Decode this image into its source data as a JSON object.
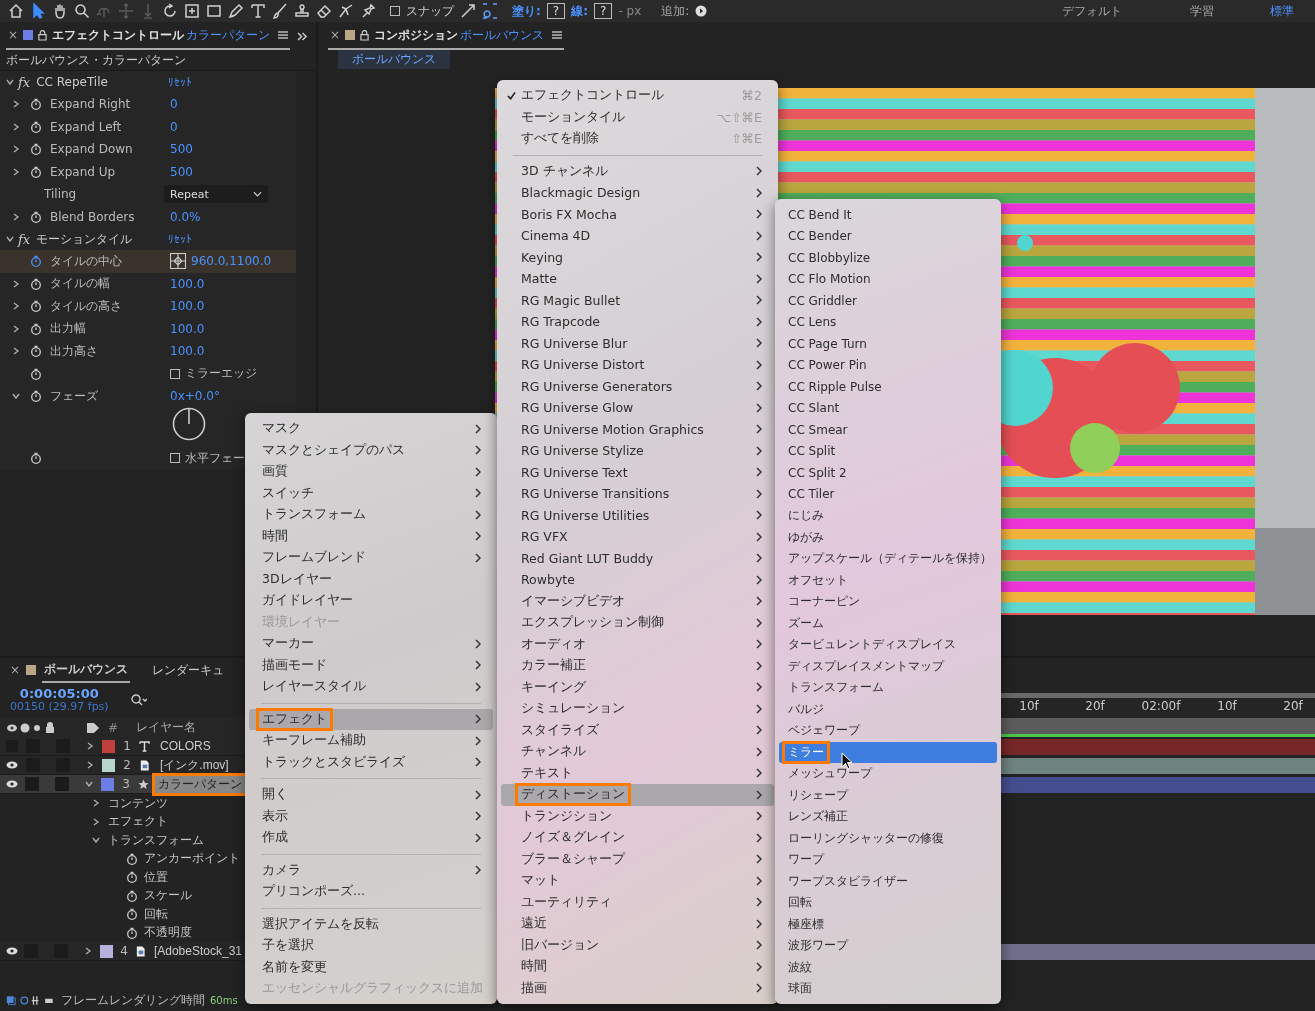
{
  "toolbar": {
    "tools": [
      {
        "kind": "home",
        "selected": false,
        "disabled": false
      },
      {
        "kind": "select",
        "selected": true,
        "disabled": false
      },
      {
        "kind": "hand",
        "selected": false,
        "disabled": false
      },
      {
        "kind": "zoom",
        "selected": false,
        "disabled": false
      },
      {
        "kind": "orbit",
        "selected": false,
        "disabled": true
      },
      {
        "kind": "pan",
        "selected": false,
        "disabled": true
      },
      {
        "kind": "dolly",
        "selected": false,
        "disabled": true
      },
      {
        "kind": "rotate",
        "selected": false,
        "disabled": false
      },
      {
        "kind": "anchor",
        "selected": false,
        "disabled": false
      },
      {
        "kind": "rect",
        "selected": false,
        "disabled": false
      },
      {
        "kind": "pen",
        "selected": false,
        "disabled": false
      },
      {
        "kind": "text",
        "selected": false,
        "disabled": false
      },
      {
        "kind": "brush",
        "selected": false,
        "disabled": false
      },
      {
        "kind": "stamp",
        "selected": false,
        "disabled": false
      },
      {
        "kind": "eraser",
        "selected": false,
        "disabled": false
      },
      {
        "kind": "roto",
        "selected": false,
        "disabled": false
      },
      {
        "kind": "pin",
        "selected": false,
        "disabled": false
      }
    ],
    "snap": {
      "label": "スナップ",
      "checked": false
    },
    "fill_label": "塗り:",
    "fill_value": "?",
    "stroke_label": "線:",
    "stroke_value": "?",
    "stroke_width": "- px",
    "add_label": "追加:",
    "workspaces": [
      {
        "label": "デフォルト",
        "selected": false
      },
      {
        "label": "学習",
        "selected": false
      },
      {
        "label": "標準",
        "selected": true
      }
    ]
  },
  "effect_panel": {
    "close": "×",
    "title": "エフェクトコントロール",
    "layer": "カラーパターン",
    "subtitle": "ボールバウンス・カラーパターン",
    "effects": [
      {
        "fx": "fx",
        "name": "CC RepeTile",
        "reset": "ﾘｾｯﾄ",
        "expanded": true,
        "params": [
          {
            "kind": "number",
            "name": "Expand Right",
            "value": "0",
            "expandable": true,
            "expanded": false,
            "selected": false
          },
          {
            "kind": "number",
            "name": "Expand Left",
            "value": "0",
            "expandable": true,
            "expanded": false,
            "selected": false
          },
          {
            "kind": "number",
            "name": "Expand Down",
            "value": "500",
            "expandable": true,
            "expanded": false,
            "selected": false
          },
          {
            "kind": "number",
            "name": "Expand Up",
            "value": "500",
            "expandable": true,
            "expanded": false,
            "selected": false
          },
          {
            "kind": "dropdown",
            "name": "Tiling",
            "value": "Repeat",
            "selected": false
          },
          {
            "kind": "number",
            "name": "Blend Borders",
            "value": "0.0%",
            "expandable": true,
            "expanded": false,
            "selected": false
          }
        ]
      },
      {
        "fx": "fx",
        "name": "モーションタイル",
        "reset": "ﾘｾｯﾄ",
        "expanded": true,
        "params": [
          {
            "kind": "point",
            "name": "タイルの中心",
            "value": "960.0,1100.0",
            "selected": true
          },
          {
            "kind": "number",
            "name": "タイルの幅",
            "value": "100.0",
            "expandable": true,
            "expanded": false,
            "selected": false
          },
          {
            "kind": "number",
            "name": "タイルの高さ",
            "value": "100.0",
            "expandable": true,
            "expanded": false,
            "selected": false
          },
          {
            "kind": "number",
            "name": "出力幅",
            "value": "100.0",
            "expandable": true,
            "expanded": false,
            "selected": false
          },
          {
            "kind": "number",
            "name": "出力高さ",
            "value": "100.0",
            "expandable": true,
            "expanded": false,
            "selected": false
          },
          {
            "kind": "checkbox",
            "label": "ミラーエッジ",
            "checked": false,
            "selected": false
          },
          {
            "kind": "angle",
            "name": "フェーズ",
            "value": "0x+0.0°",
            "expandable": true,
            "expanded": true,
            "selected": false
          },
          {
            "kind": "checkbox",
            "label": "水平フェー",
            "checked": false,
            "selected": false
          }
        ]
      }
    ]
  },
  "composition_panel": {
    "close": "×",
    "title": "コンポジション",
    "comp": "ボールバウンス",
    "tabs": [
      {
        "label": "ボールバウンス",
        "selected": true
      }
    ]
  },
  "timeline": {
    "close": "×",
    "tabs": [
      {
        "label": "ボールバウンス",
        "selected": true
      },
      {
        "label": "レンダーキュ",
        "selected": false
      }
    ],
    "timecode": "0:00:05:00",
    "frames": "00150 (29.97 fps)",
    "col_number": "#",
    "col_name": "レイヤー名",
    "ruler": [
      "10f",
      "20f",
      "02:00f",
      "10f",
      "20f"
    ],
    "layers": [
      {
        "number": "1",
        "color": "#c0403e",
        "kind": "text",
        "name": "COLORS",
        "visible": false,
        "expanded": false,
        "selected": false,
        "annotated": false
      },
      {
        "number": "2",
        "color": "#b5d5cd",
        "kind": "footage",
        "name": "[インク.mov]",
        "visible": true,
        "expanded": false,
        "selected": false,
        "annotated": false
      },
      {
        "number": "3",
        "color": "#6d7de6",
        "kind": "shape",
        "name": "カラーパターン",
        "visible": true,
        "expanded": true,
        "selected": true,
        "annotated": true,
        "children": [
          {
            "kind": "group",
            "name": "コンテンツ",
            "expanded": false
          },
          {
            "kind": "group",
            "name": "エフェクト",
            "expanded": false
          },
          {
            "kind": "group",
            "name": "トランスフォーム",
            "expanded": true,
            "children": [
              {
                "kind": "property",
                "name": "アンカーポイント"
              },
              {
                "kind": "property",
                "name": "位置"
              },
              {
                "kind": "property",
                "name": "スケール"
              },
              {
                "kind": "property",
                "name": "回転"
              },
              {
                "kind": "property",
                "name": "不透明度"
              }
            ]
          }
        ]
      },
      {
        "number": "4",
        "color": "#b4b1dc",
        "kind": "footage",
        "name": "[AdobeStock_31",
        "visible": true,
        "expanded": false,
        "selected": false,
        "annotated": false
      }
    ],
    "footer_label": "フレームレンダリング時間",
    "footer_time": "60ms"
  },
  "menus": [
    {
      "items": [
        {
          "kind": "item",
          "label": "マスク",
          "submenu": true,
          "disabled": false,
          "selected": false,
          "annotated": false
        },
        {
          "kind": "item",
          "label": "マスクとシェイプのパス",
          "submenu": true,
          "disabled": false,
          "selected": false,
          "annotated": false
        },
        {
          "kind": "item",
          "label": "画質",
          "submenu": true,
          "disabled": false,
          "selected": false,
          "annotated": false
        },
        {
          "kind": "item",
          "label": "スイッチ",
          "submenu": true,
          "disabled": false,
          "selected": false,
          "annotated": false
        },
        {
          "kind": "item",
          "label": "トランスフォーム",
          "submenu": true,
          "disabled": false,
          "selected": false,
          "annotated": false
        },
        {
          "kind": "item",
          "label": "時間",
          "submenu": true,
          "disabled": false,
          "selected": false,
          "annotated": false
        },
        {
          "kind": "item",
          "label": "フレームブレンド",
          "submenu": true,
          "disabled": false,
          "selected": false,
          "annotated": false
        },
        {
          "kind": "item",
          "label": "3Dレイヤー",
          "submenu": false,
          "disabled": false,
          "selected": false,
          "annotated": false
        },
        {
          "kind": "item",
          "label": "ガイドレイヤー",
          "submenu": false,
          "disabled": false,
          "selected": false,
          "annotated": false
        },
        {
          "kind": "item",
          "label": "環境レイヤー",
          "submenu": false,
          "disabled": true,
          "selected": false,
          "annotated": false
        },
        {
          "kind": "item",
          "label": "マーカー",
          "submenu": true,
          "disabled": false,
          "selected": false,
          "annotated": false
        },
        {
          "kind": "item",
          "label": "描画モード",
          "submenu": true,
          "disabled": false,
          "selected": false,
          "annotated": false
        },
        {
          "kind": "item",
          "label": "レイヤースタイル",
          "submenu": true,
          "disabled": false,
          "selected": false,
          "annotated": false
        },
        {
          "kind": "separator"
        },
        {
          "kind": "item",
          "label": "エフェクト",
          "submenu": true,
          "disabled": false,
          "selected": true,
          "annotated": true
        },
        {
          "kind": "item",
          "label": "キーフレーム補助",
          "submenu": true,
          "disabled": false,
          "selected": false,
          "annotated": false
        },
        {
          "kind": "item",
          "label": "トラックとスタビライズ",
          "submenu": true,
          "disabled": false,
          "selected": false,
          "annotated": false
        },
        {
          "kind": "separator"
        },
        {
          "kind": "item",
          "label": "開く",
          "submenu": true,
          "disabled": false,
          "selected": false,
          "annotated": false
        },
        {
          "kind": "item",
          "label": "表示",
          "submenu": true,
          "disabled": false,
          "selected": false,
          "annotated": false
        },
        {
          "kind": "item",
          "label": "作成",
          "submenu": true,
          "disabled": false,
          "selected": false,
          "annotated": false
        },
        {
          "kind": "separator"
        },
        {
          "kind": "item",
          "label": "カメラ",
          "submenu": true,
          "disabled": false,
          "selected": false,
          "annotated": false
        },
        {
          "kind": "item",
          "label": "プリコンポーズ...",
          "submenu": false,
          "disabled": false,
          "selected": false,
          "annotated": false
        },
        {
          "kind": "separator"
        },
        {
          "kind": "item",
          "label": "選択アイテムを反転",
          "submenu": false,
          "disabled": false,
          "selected": false,
          "annotated": false
        },
        {
          "kind": "item",
          "label": "子を選択",
          "submenu": false,
          "disabled": false,
          "selected": false,
          "annotated": false
        },
        {
          "kind": "item",
          "label": "名前を変更",
          "submenu": false,
          "disabled": false,
          "selected": false,
          "annotated": false
        },
        {
          "kind": "item",
          "label": "エッセンシャルグラフィックスに追加",
          "submenu": false,
          "disabled": true,
          "selected": false,
          "annotated": false
        }
      ]
    },
    {
      "items": [
        {
          "kind": "check",
          "label": "エフェクトコントロール",
          "shortcut": "⌘2",
          "checked": true
        },
        {
          "kind": "check",
          "label": "モーションタイル",
          "shortcut": "⌥⇧⌘E",
          "checked": false
        },
        {
          "kind": "check",
          "label": "すべてを削除",
          "shortcut": "⇧⌘E",
          "checked": false
        },
        {
          "kind": "separator"
        },
        {
          "kind": "item",
          "label": "3D チャンネル",
          "submenu": true,
          "selected": false,
          "annotated": false
        },
        {
          "kind": "item",
          "label": "Blackmagic Design",
          "submenu": true,
          "selected": false,
          "annotated": false
        },
        {
          "kind": "item",
          "label": "Boris FX Mocha",
          "submenu": true,
          "selected": false,
          "annotated": false
        },
        {
          "kind": "item",
          "label": "Cinema 4D",
          "submenu": true,
          "selected": false,
          "annotated": false
        },
        {
          "kind": "item",
          "label": "Keying",
          "submenu": true,
          "selected": false,
          "annotated": false
        },
        {
          "kind": "item",
          "label": "Matte",
          "submenu": true,
          "selected": false,
          "annotated": false
        },
        {
          "kind": "item",
          "label": "RG Magic Bullet",
          "submenu": true,
          "selected": false,
          "annotated": false
        },
        {
          "kind": "item",
          "label": "RG Trapcode",
          "submenu": true,
          "selected": false,
          "annotated": false
        },
        {
          "kind": "item",
          "label": "RG Universe Blur",
          "submenu": true,
          "selected": false,
          "annotated": false
        },
        {
          "kind": "item",
          "label": "RG Universe Distort",
          "submenu": true,
          "selected": false,
          "annotated": false
        },
        {
          "kind": "item",
          "label": "RG Universe Generators",
          "submenu": true,
          "selected": false,
          "annotated": false
        },
        {
          "kind": "item",
          "label": "RG Universe Glow",
          "submenu": true,
          "selected": false,
          "annotated": false
        },
        {
          "kind": "item",
          "label": "RG Universe Motion Graphics",
          "submenu": true,
          "selected": false,
          "annotated": false
        },
        {
          "kind": "item",
          "label": "RG Universe Stylize",
          "submenu": true,
          "selected": false,
          "annotated": false
        },
        {
          "kind": "item",
          "label": "RG Universe Text",
          "submenu": true,
          "selected": false,
          "annotated": false
        },
        {
          "kind": "item",
          "label": "RG Universe Transitions",
          "submenu": true,
          "selected": false,
          "annotated": false
        },
        {
          "kind": "item",
          "label": "RG Universe Utilities",
          "submenu": true,
          "selected": false,
          "annotated": false
        },
        {
          "kind": "item",
          "label": "RG VFX",
          "submenu": true,
          "selected": false,
          "annotated": false
        },
        {
          "kind": "item",
          "label": "Red Giant LUT Buddy",
          "submenu": true,
          "selected": false,
          "annotated": false
        },
        {
          "kind": "item",
          "label": "Rowbyte",
          "submenu": true,
          "selected": false,
          "annotated": false
        },
        {
          "kind": "item",
          "label": "イマーシブビデオ",
          "submenu": true,
          "selected": false,
          "annotated": false
        },
        {
          "kind": "item",
          "label": "エクスプレッション制御",
          "submenu": true,
          "selected": false,
          "annotated": false
        },
        {
          "kind": "item",
          "label": "オーディオ",
          "submenu": true,
          "selected": false,
          "annotated": false
        },
        {
          "kind": "item",
          "label": "カラー補正",
          "submenu": true,
          "selected": false,
          "annotated": false
        },
        {
          "kind": "item",
          "label": "キーイング",
          "submenu": true,
          "selected": false,
          "annotated": false
        },
        {
          "kind": "item",
          "label": "シミュレーション",
          "submenu": true,
          "selected": false,
          "annotated": false
        },
        {
          "kind": "item",
          "label": "スタイライズ",
          "submenu": true,
          "selected": false,
          "annotated": false
        },
        {
          "kind": "item",
          "label": "チャンネル",
          "submenu": true,
          "selected": false,
          "annotated": false
        },
        {
          "kind": "item",
          "label": "テキスト",
          "submenu": true,
          "selected": false,
          "annotated": false
        },
        {
          "kind": "item",
          "label": "ディストーション",
          "submenu": true,
          "selected": true,
          "annotated": true
        },
        {
          "kind": "item",
          "label": "トランジション",
          "submenu": true,
          "selected": false,
          "annotated": false
        },
        {
          "kind": "item",
          "label": "ノイズ＆グレイン",
          "submenu": true,
          "selected": false,
          "annotated": false
        },
        {
          "kind": "item",
          "label": "ブラー＆シャープ",
          "submenu": true,
          "selected": false,
          "annotated": false
        },
        {
          "kind": "item",
          "label": "マット",
          "submenu": true,
          "selected": false,
          "annotated": false
        },
        {
          "kind": "item",
          "label": "ユーティリティ",
          "submenu": true,
          "selected": false,
          "annotated": false
        },
        {
          "kind": "item",
          "label": "遠近",
          "submenu": true,
          "selected": false,
          "annotated": false
        },
        {
          "kind": "item",
          "label": "旧バージョン",
          "submenu": true,
          "selected": false,
          "annotated": false
        },
        {
          "kind": "item",
          "label": "時間",
          "submenu": true,
          "selected": false,
          "annotated": false
        },
        {
          "kind": "item",
          "label": "描画",
          "submenu": true,
          "selected": false,
          "annotated": false
        }
      ]
    },
    {
      "items": [
        {
          "kind": "item",
          "label": "CC Bend It",
          "selected": false,
          "annotated": false
        },
        {
          "kind": "item",
          "label": "CC Bender",
          "selected": false,
          "annotated": false
        },
        {
          "kind": "item",
          "label": "CC Blobbylize",
          "selected": false,
          "annotated": false
        },
        {
          "kind": "item",
          "label": "CC Flo Motion",
          "selected": false,
          "annotated": false
        },
        {
          "kind": "item",
          "label": "CC Griddler",
          "selected": false,
          "annotated": false
        },
        {
          "kind": "item",
          "label": "CC Lens",
          "selected": false,
          "annotated": false
        },
        {
          "kind": "item",
          "label": "CC Page Turn",
          "selected": false,
          "annotated": false
        },
        {
          "kind": "item",
          "label": "CC Power Pin",
          "selected": false,
          "annotated": false
        },
        {
          "kind": "item",
          "label": "CC Ripple Pulse",
          "selected": false,
          "annotated": false
        },
        {
          "kind": "item",
          "label": "CC Slant",
          "selected": false,
          "annotated": false
        },
        {
          "kind": "item",
          "label": "CC Smear",
          "selected": false,
          "annotated": false
        },
        {
          "kind": "item",
          "label": "CC Split",
          "selected": false,
          "annotated": false
        },
        {
          "kind": "item",
          "label": "CC Split 2",
          "selected": false,
          "annotated": false
        },
        {
          "kind": "item",
          "label": "CC Tiler",
          "selected": false,
          "annotated": false
        },
        {
          "kind": "item",
          "label": "にじみ",
          "selected": false,
          "annotated": false
        },
        {
          "kind": "item",
          "label": "ゆがみ",
          "selected": false,
          "annotated": false
        },
        {
          "kind": "item",
          "label": "アップスケール（ディテールを保持）",
          "selected": false,
          "annotated": false
        },
        {
          "kind": "item",
          "label": "オフセット",
          "selected": false,
          "annotated": false
        },
        {
          "kind": "item",
          "label": "コーナーピン",
          "selected": false,
          "annotated": false
        },
        {
          "kind": "item",
          "label": "ズーム",
          "selected": false,
          "annotated": false
        },
        {
          "kind": "item",
          "label": "タービュレントディスプレイス",
          "selected": false,
          "annotated": false
        },
        {
          "kind": "item",
          "label": "ディスプレイスメントマップ",
          "selected": false,
          "annotated": false
        },
        {
          "kind": "item",
          "label": "トランスフォーム",
          "selected": false,
          "annotated": false
        },
        {
          "kind": "item",
          "label": "バルジ",
          "selected": false,
          "annotated": false
        },
        {
          "kind": "item",
          "label": "ベジェワープ",
          "selected": false,
          "annotated": false
        },
        {
          "kind": "item",
          "label": "ミラー",
          "selected": true,
          "annotated": true
        },
        {
          "kind": "item",
          "label": "メッシュワープ",
          "selected": false,
          "annotated": false
        },
        {
          "kind": "item",
          "label": "リシェープ",
          "selected": false,
          "annotated": false
        },
        {
          "kind": "item",
          "label": "レンズ補正",
          "selected": false,
          "annotated": false
        },
        {
          "kind": "item",
          "label": "ローリングシャッターの修復",
          "selected": false,
          "annotated": false
        },
        {
          "kind": "item",
          "label": "ワープ",
          "selected": false,
          "annotated": false
        },
        {
          "kind": "item",
          "label": "ワープスタビライザー",
          "selected": false,
          "annotated": false
        },
        {
          "kind": "item",
          "label": "回転",
          "selected": false,
          "annotated": false
        },
        {
          "kind": "item",
          "label": "極座標",
          "selected": false,
          "annotated": false
        },
        {
          "kind": "item",
          "label": "波形ワープ",
          "selected": false,
          "annotated": false
        },
        {
          "kind": "item",
          "label": "波紋",
          "selected": false,
          "annotated": false
        },
        {
          "kind": "item",
          "label": "球面",
          "selected": false,
          "annotated": false
        }
      ]
    }
  ]
}
